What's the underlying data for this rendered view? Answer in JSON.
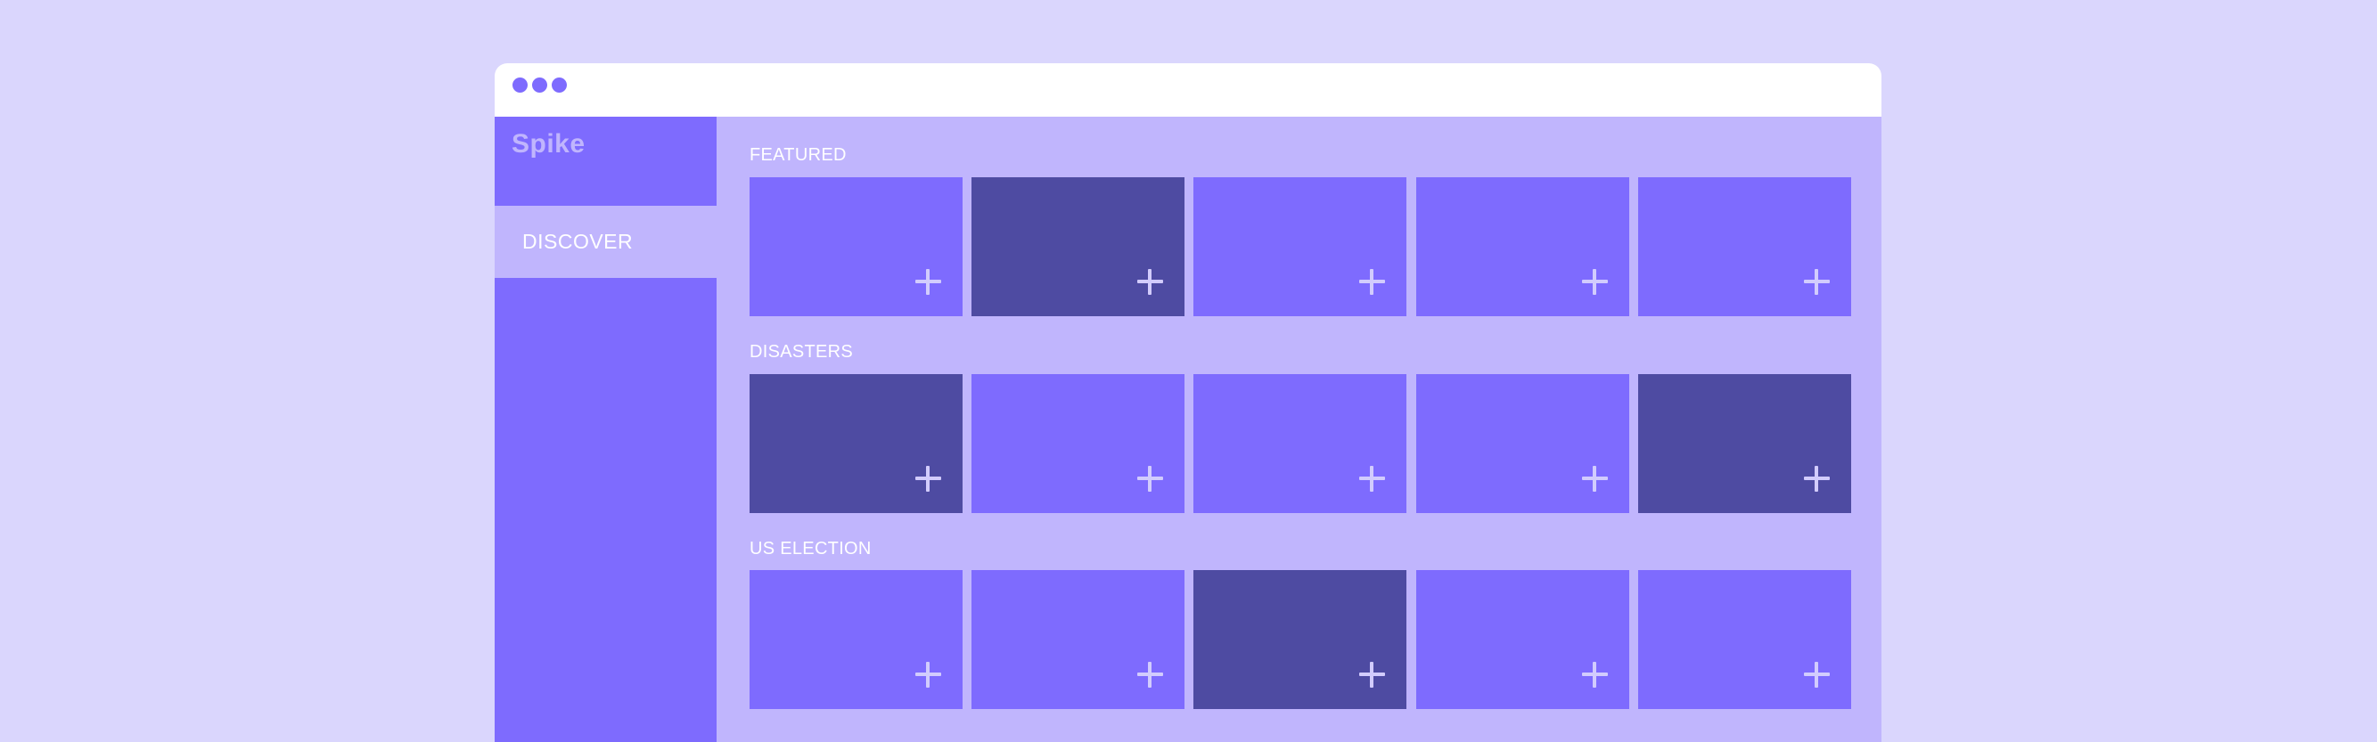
{
  "app": {
    "brand": "Spike"
  },
  "window": {
    "controls": [
      "window-dot-1",
      "window-dot-2",
      "window-dot-3"
    ]
  },
  "sidebar": {
    "items": [
      {
        "label": "DISCOVER",
        "active": true
      }
    ]
  },
  "sections": [
    {
      "title": "FEATURED",
      "cards": [
        "light",
        "dark",
        "light",
        "light",
        "light"
      ]
    },
    {
      "title": "DISASTERS",
      "cards": [
        "dark",
        "light",
        "light",
        "light",
        "dark"
      ]
    },
    {
      "title": "US ELECTION",
      "cards": [
        "light",
        "light",
        "dark",
        "light",
        "light"
      ]
    }
  ],
  "card_icon": "plus-icon",
  "colors": {
    "background": "#dad6fd",
    "accent": "#7e6bfe",
    "accent_dark": "#4e4ba2",
    "panel": "#c0b5fd",
    "icon": "#d2ccfd"
  }
}
